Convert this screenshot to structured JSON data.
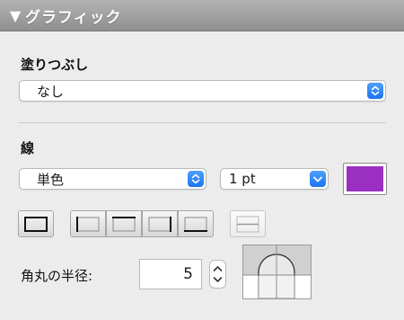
{
  "panel": {
    "title": "グラフィック"
  },
  "fill": {
    "label": "塗りつぶし",
    "value": "なし"
  },
  "stroke": {
    "label": "線",
    "type_value": "単色",
    "width_value": "1 pt",
    "color": "#9b2fc1"
  },
  "border_buttons": [
    {
      "name": "all-borders"
    },
    {
      "name": "left-border"
    },
    {
      "name": "top-border"
    },
    {
      "name": "right-border"
    },
    {
      "name": "bottom-border"
    },
    {
      "name": "inner-horizontal-border"
    }
  ],
  "corner_radius": {
    "label": "角丸の半径:",
    "value": "5"
  },
  "colors": {
    "accent_blue": "#1c74f2",
    "header_gray": "#9a9a9a",
    "stroke_swatch": "#9b2fc1"
  }
}
